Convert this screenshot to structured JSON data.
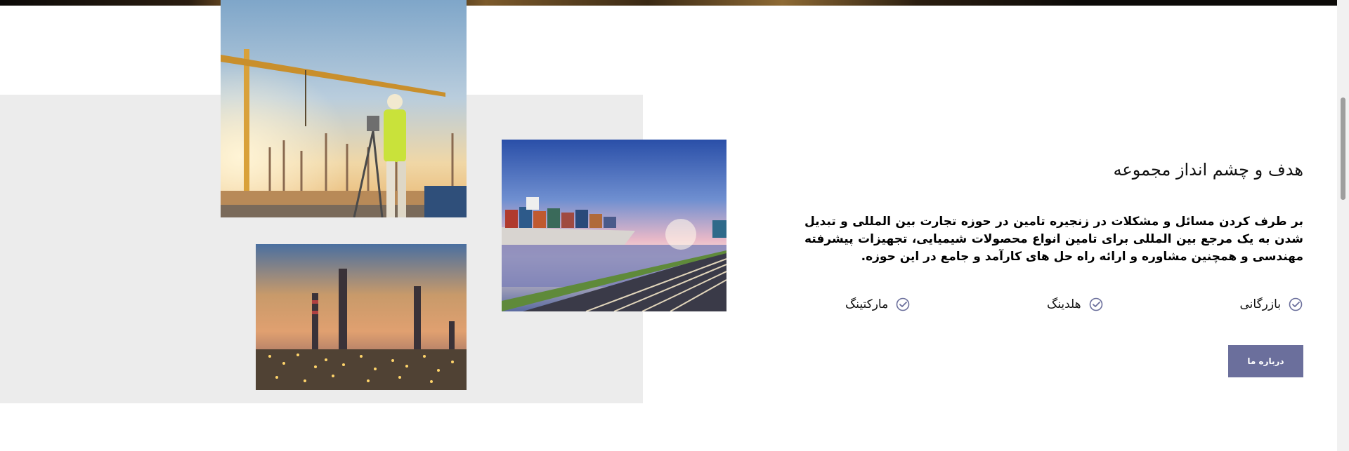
{
  "section": {
    "heading": "هدف و چشم انداز مجموعه",
    "paragraph": "بر طرف کردن مسائل و مشکلات در زنجیره تامین در حوزه تجارت بین المللی و تبدیل شدن به یک مرجع بین المللی برای تامین انواع محصولات شیمیایی، تجهیزات پیشرفته مهندسی و همچنین مشاوره و ارائه راه حل های کارآمد و جامع در این حوزه.",
    "features": [
      {
        "label": "بازرگانی",
        "icon": "check-circle-icon"
      },
      {
        "label": "هلدینگ",
        "icon": "check-circle-icon"
      },
      {
        "label": "مارکتینگ",
        "icon": "check-circle-icon"
      }
    ],
    "button_label": "درباره ما"
  },
  "images": {
    "construction": "construction-site-photo",
    "ship": "cargo-ship-photo",
    "refinery": "refinery-photo"
  },
  "colors": {
    "accent": "#6b6f9c",
    "panel": "#ececec",
    "icon": "#6b6f9c"
  }
}
